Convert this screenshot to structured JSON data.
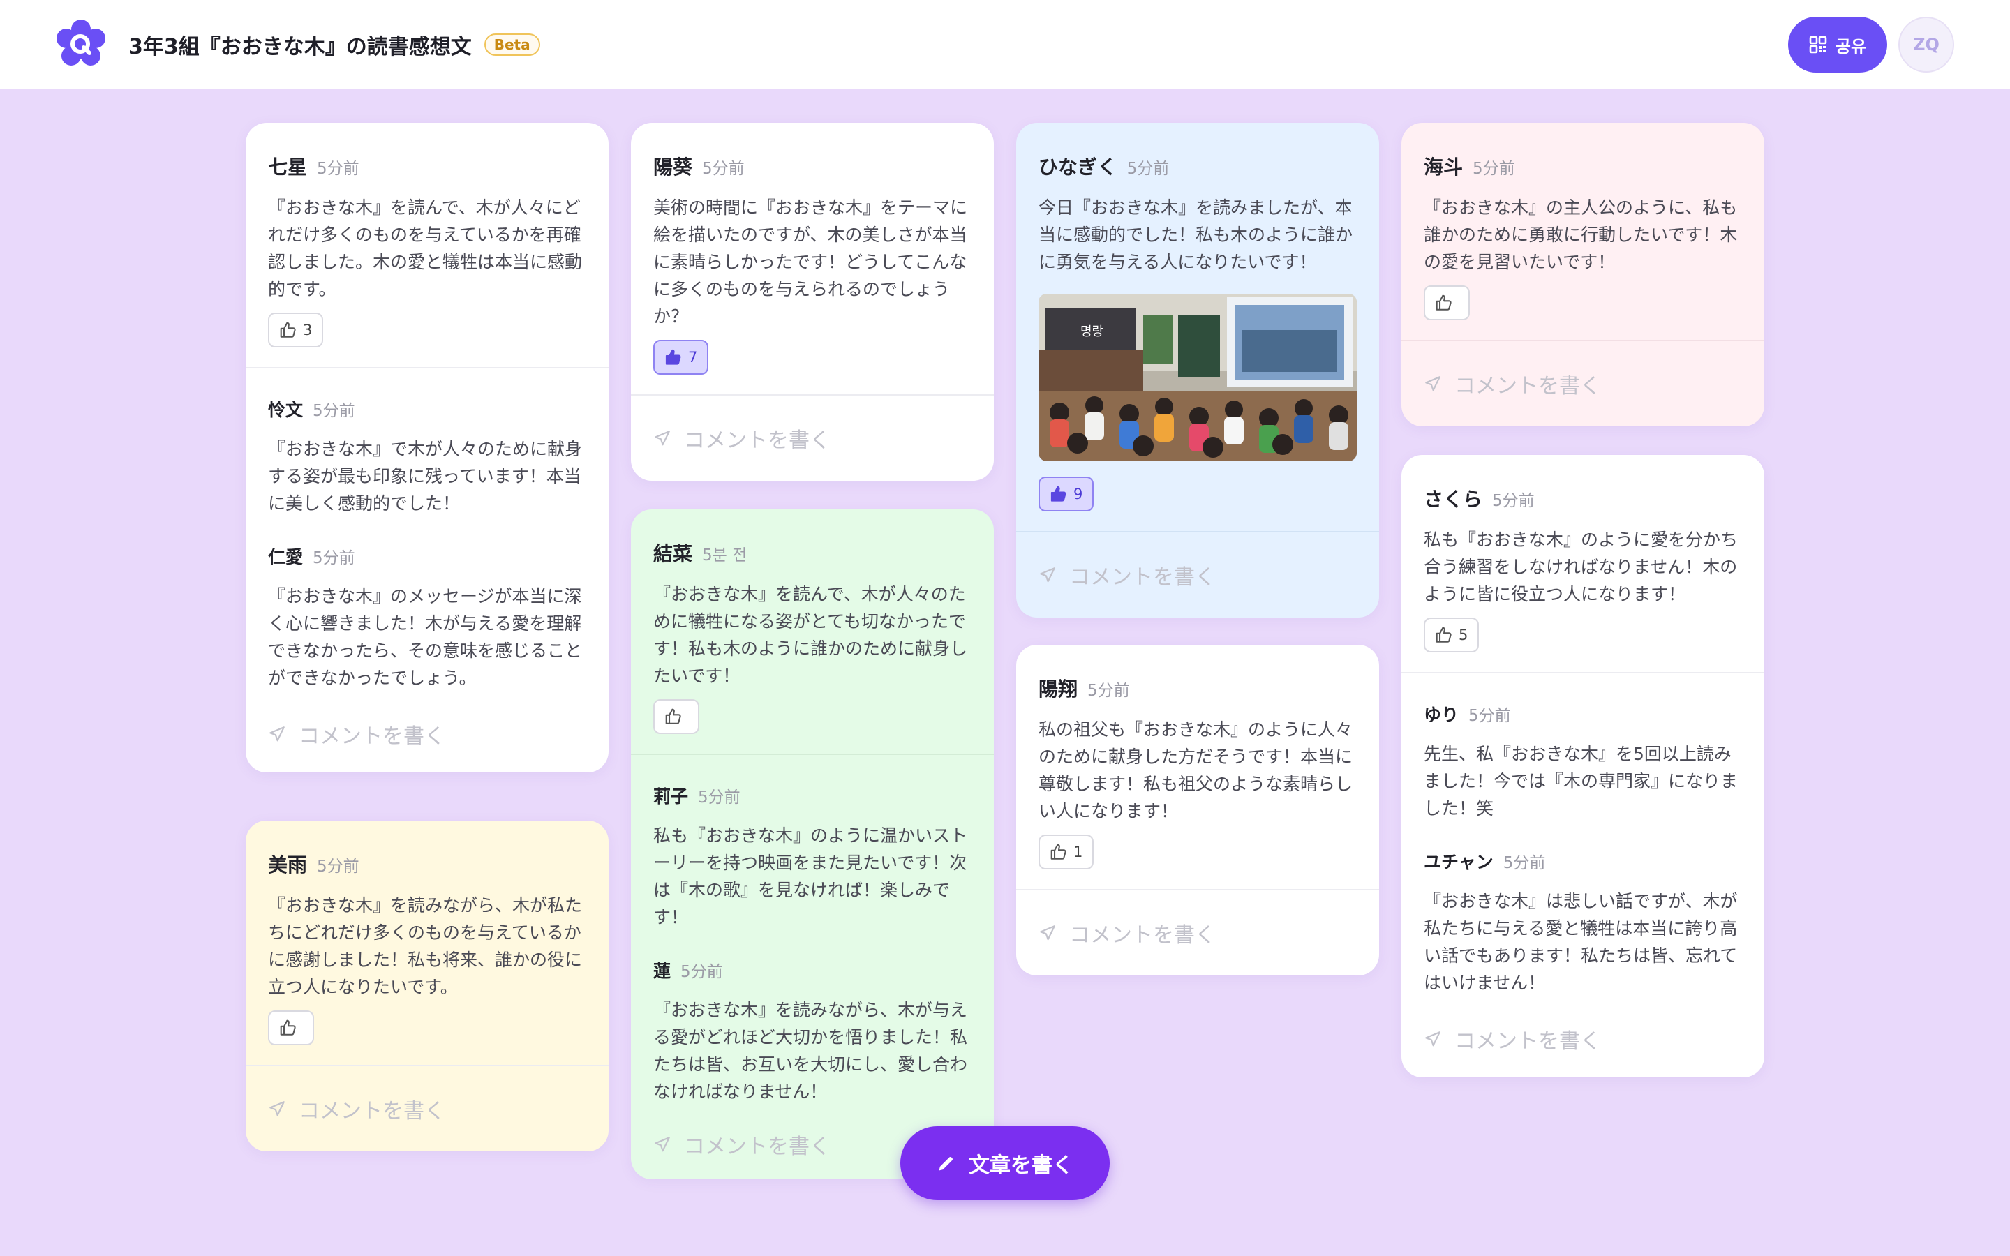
{
  "header": {
    "title": "3年3組『おおきな木』の読書感想文",
    "badge": "Beta",
    "share_label": "공유",
    "avatar_initials": "ZQ"
  },
  "comment_placeholder": "コメントを書く",
  "fab_label": "文章を書く",
  "colors": {
    "background": "#e9d9fb",
    "accent": "#6a4ff5",
    "fab": "#7b2ff0",
    "card_white": "#ffffff",
    "card_yellow": "#fff9e0",
    "card_green": "#e4fbe7",
    "card_blue": "#e5f1ff",
    "card_pink": "#fff0f3"
  },
  "cards": [
    {
      "author": "七星",
      "time": "5分前",
      "body": "『おおきな木』を読んで、木が人々にどれだけ多くのものを与えているかを再確認しました。木の愛と犠牲は本当に感動的です。",
      "likes": "3",
      "replies": [
        {
          "author": "怜文",
          "time": "5分前",
          "body": "『おおきな木』で木が人々のために献身する姿が最も印象に残っています！本当に美しく感動的でした！"
        },
        {
          "author": "仁愛",
          "time": "5分前",
          "body": "『おおきな木』のメッセージが本当に深く心に響きました！木が与える愛を理解できなかったら、その意味を感じることができなかったでしょう。"
        }
      ]
    },
    {
      "author": "美雨",
      "time": "5分前",
      "body": "『おおきな木』を読みながら、木が私たちにどれだけ多くのものを与えているかに感謝しました！私も将来、誰かの役に立つ人になりたいです。",
      "likes": ""
    },
    {
      "author": "陽葵",
      "time": "5分前",
      "body": "美術の時間に『おおきな木』をテーマに絵を描いたのですが、木の美しさが本当に素晴らしかったです！どうしてこんなに多くのものを与えられるのでしょうか？",
      "likes": "7"
    },
    {
      "author": "結菜",
      "time": "5분 전",
      "body": "『おおきな木』を読んで、木が人々のために犠牲になる姿がとても切なかったです！私も木のように誰かのために献身したいです！",
      "likes": "",
      "replies": [
        {
          "author": "莉子",
          "time": "5分前",
          "body": "私も『おおきな木』のように温かいストーリーを持つ映画をまた見たいです！次は『木の歌』を見なければ！楽しみです！"
        },
        {
          "author": "蓮",
          "time": "5分前",
          "body": "『おおきな木』を読みながら、木が与える愛がどれほど大切かを悟りました！私たちは皆、お互いを大切にし、愛し合わなければなりません！"
        }
      ]
    },
    {
      "author": "ひなぎく",
      "time": "5分前",
      "body": "今日『おおきな木』を読みましたが、本当に感動的でした！私も木のように誰かに勇気を与える人になりたいです！",
      "likes": "9",
      "photo_sign": "명랑"
    },
    {
      "author": "陽翔",
      "time": "5分前",
      "body": "私の祖父も『おおきな木』のように人々のために献身した方だそうです！本当に尊敬します！私も祖父のような素晴らしい人になります！",
      "likes": "1"
    },
    {
      "author": "海斗",
      "time": "5分前",
      "body": "『おおきな木』の主人公のように、私も誰かのために勇敢に行動したいです！木の愛を見習いたいです！",
      "likes": ""
    },
    {
      "author": "さくら",
      "time": "5分前",
      "body": "私も『おおきな木』のように愛を分かち合う練習をしなければなりません！木のように皆に役立つ人になります！",
      "likes": "5",
      "replies": [
        {
          "author": "ゆり",
          "time": "5分前",
          "body": "先生、私『おおきな木』を5回以上読みました！今では『木の専門家』になりました！笑"
        },
        {
          "author": "ユチャン",
          "time": "5分前",
          "body": "『おおきな木』は悲しい話ですが、木が私たちに与える愛と犠牲は本当に誇り高い話でもあります！私たちは皆、忘れてはいけません！"
        }
      ]
    }
  ]
}
